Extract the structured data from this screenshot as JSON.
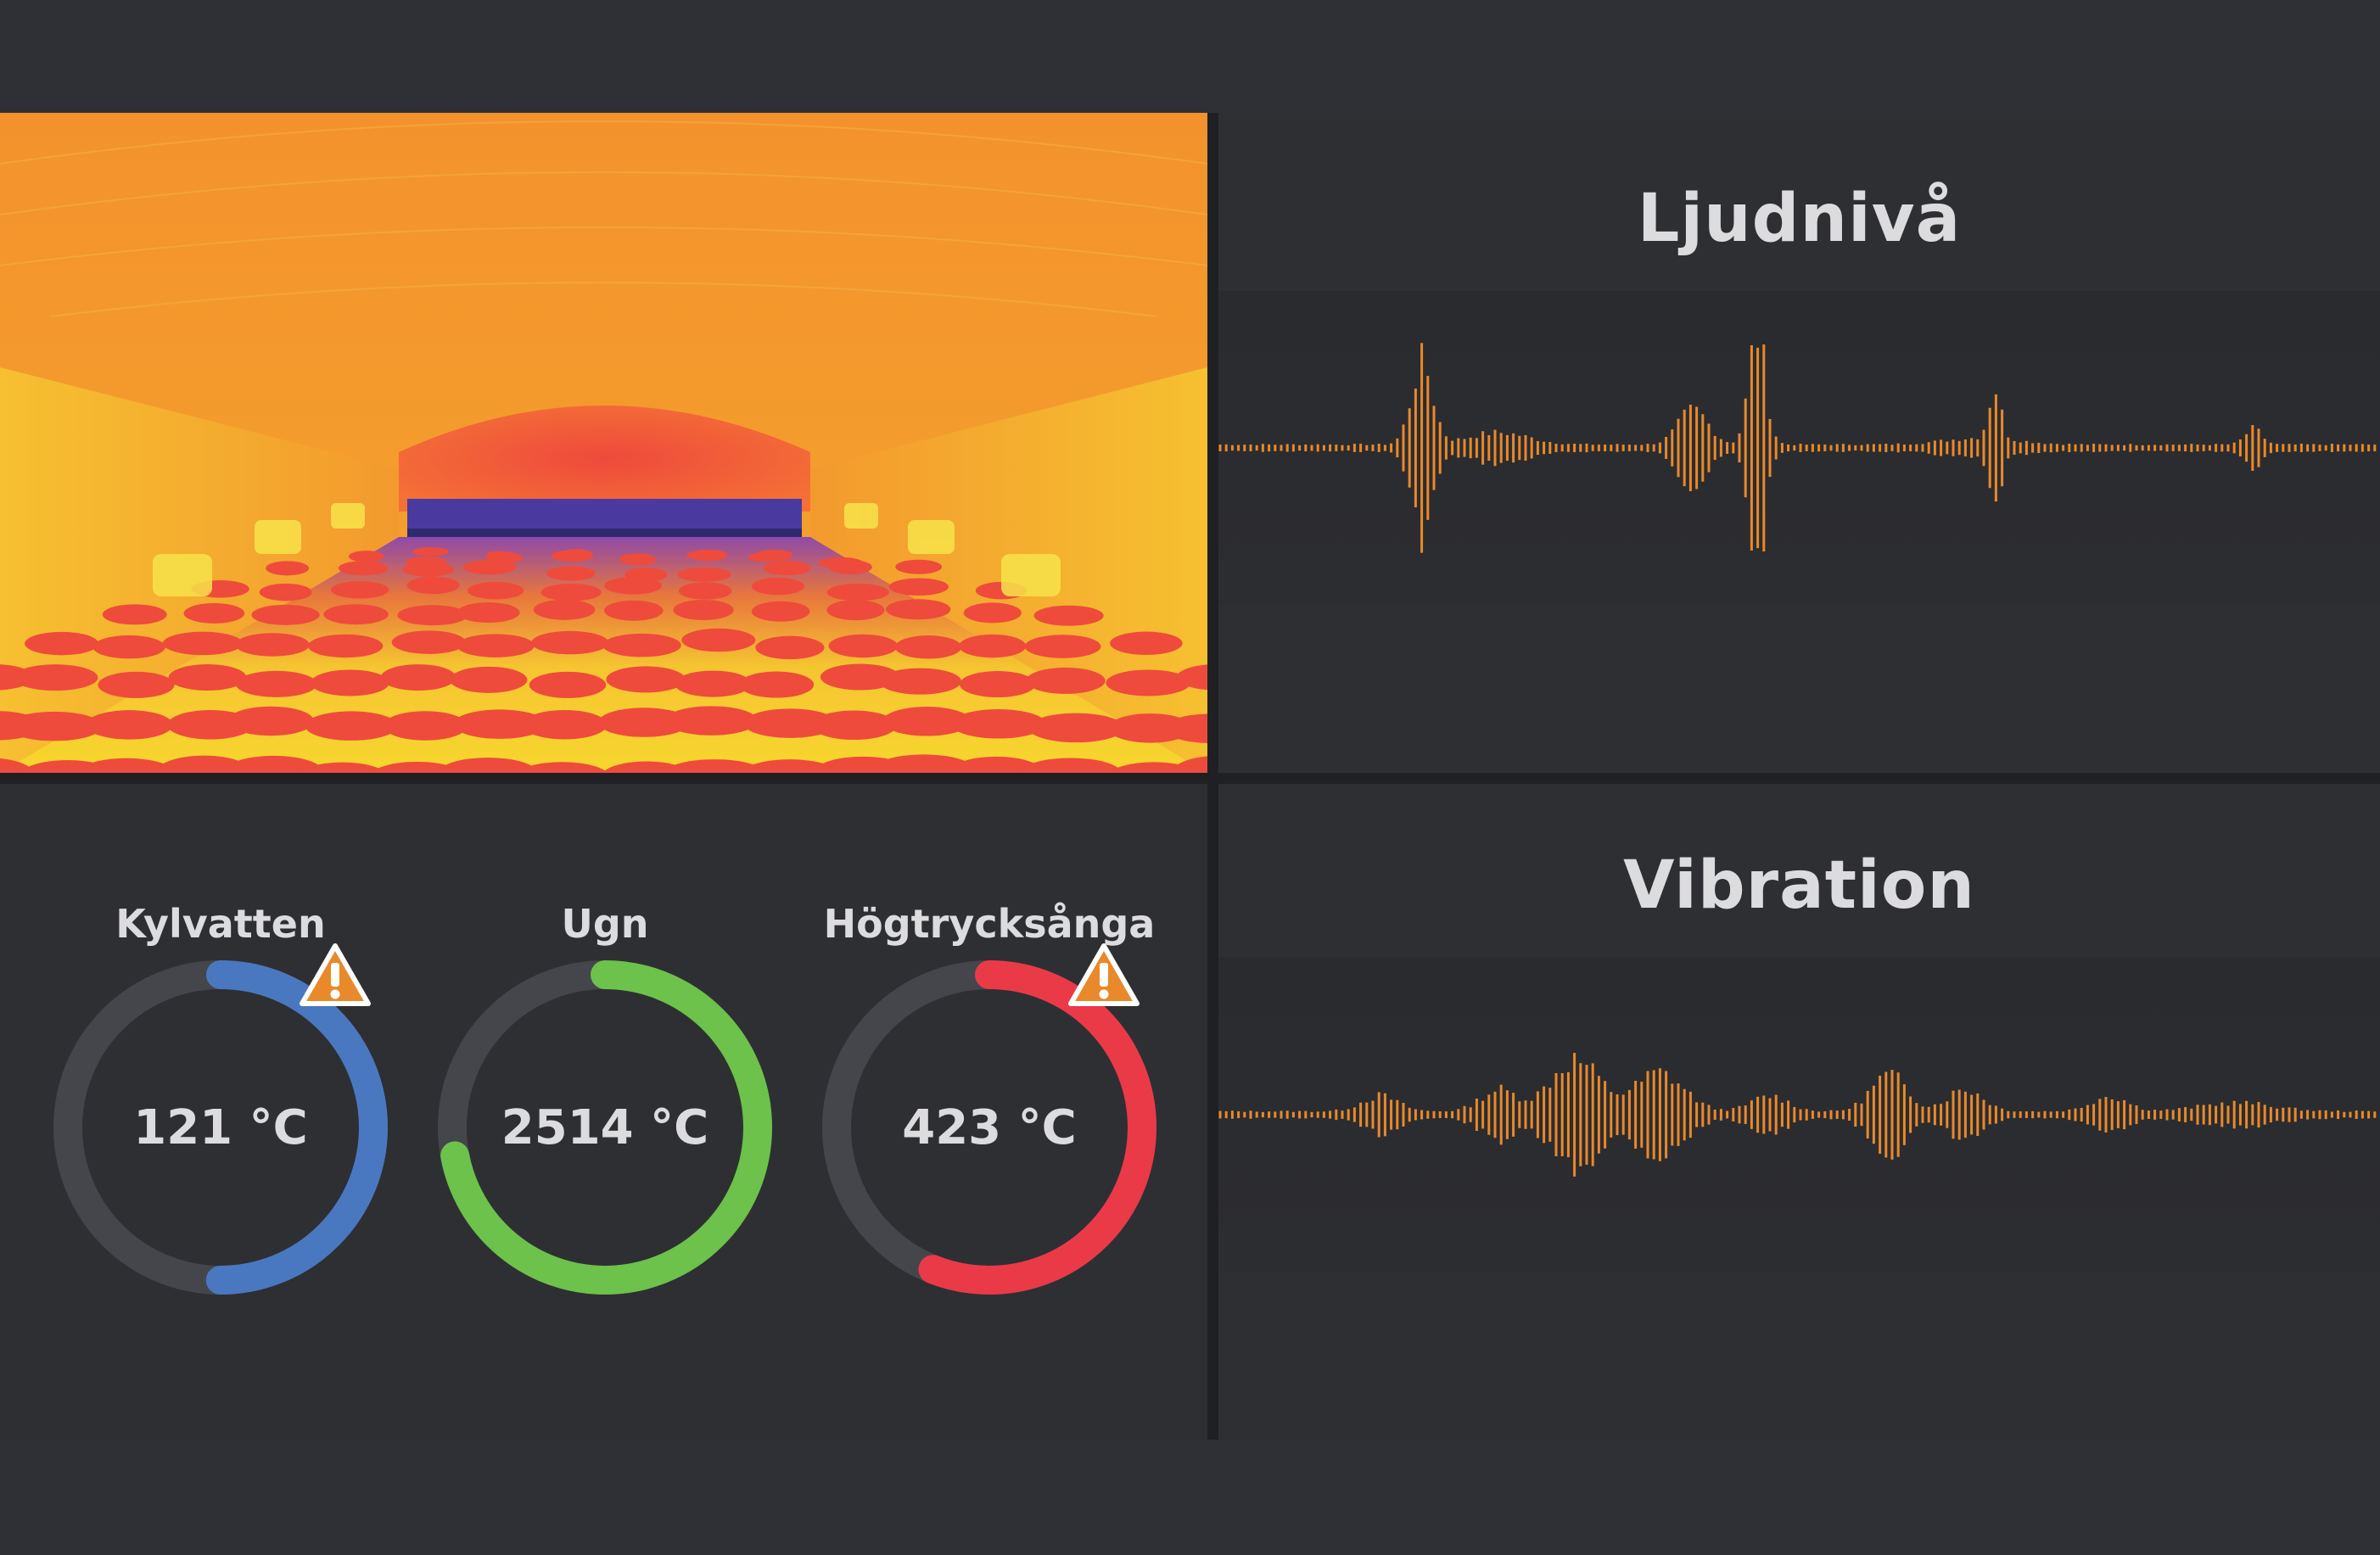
{
  "panels": {
    "sound": {
      "title": "Ljudnivå"
    },
    "vibration": {
      "title": "Vibration"
    }
  },
  "colors": {
    "background": "#2f3035",
    "panel": "#2e2f33",
    "waveform": "#e8892b",
    "gauge_track": "#44464b",
    "warning": "#e8892b"
  },
  "gauges": [
    {
      "label": "Kylvatten",
      "value": "121 °C",
      "fraction": 0.5,
      "color": "#4a78c0",
      "warning": true,
      "icon": "warning-triangle-icon"
    },
    {
      "label": "Ugn",
      "value": "2514 °C",
      "fraction": 0.72,
      "color": "#6cc24a",
      "warning": false,
      "icon": ""
    },
    {
      "label": "Högtrycksånga",
      "value": "423 °C",
      "fraction": 0.56,
      "color": "#ea3a48",
      "warning": true,
      "icon": "warning-triangle-icon"
    }
  ]
}
